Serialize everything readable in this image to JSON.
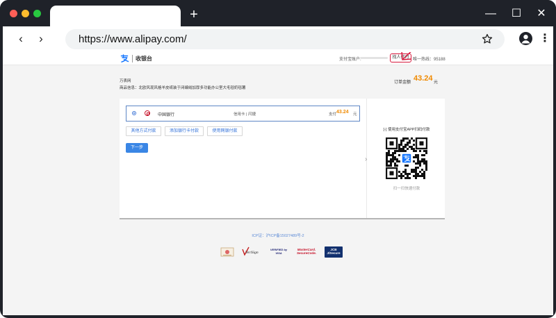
{
  "browser": {
    "url": "https://www.alipay.com/",
    "window_controls": {
      "minimize": "—",
      "maximize": "☐",
      "close": "✕"
    },
    "new_tab_label": "+",
    "nav": {
      "back": "‹",
      "forward": "›"
    },
    "menu_label": "⋮"
  },
  "page": {
    "header": {
      "brand_name": "收银台",
      "account_label": "支付宝账户:",
      "proxy_pay_button": "找人代付",
      "hotline": "唯一热线：95188"
    },
    "order": {
      "merchant": "万表网",
      "goods": "商品信息：北欧风现风格羊皮纸装于闭编绒加厚多功能办公室大毛毯奶毯薯",
      "amount_label": "订单金额",
      "amount": "43.24",
      "amount_unit": "元"
    },
    "payment": {
      "bank_name": "中国银行",
      "card_type": "信用卡 | 闪捷",
      "pay_label": "支付",
      "pay_amount": "43.24",
      "pay_unit": "元",
      "options": [
        "其他方式付款",
        "添加银行卡付款",
        "使用网银付款"
      ],
      "next_button": "下一步"
    },
    "qr": {
      "title": "[-] 使用支付宝APP扫码付款",
      "footer": "扫一扫快速付款"
    },
    "footer": {
      "icp": "ICP证：沪ICP备15027489号-2",
      "badges": [
        "VeriSign",
        "VERIFIED by VISA",
        "MasterCard. SecureCode.",
        "JCB J/Secure"
      ]
    }
  },
  "colors": {
    "browser_chrome": "#1f2229",
    "accent_blue": "#3a86e5",
    "amount_orange": "#f08a00",
    "highlight_red": "#d6173b"
  }
}
